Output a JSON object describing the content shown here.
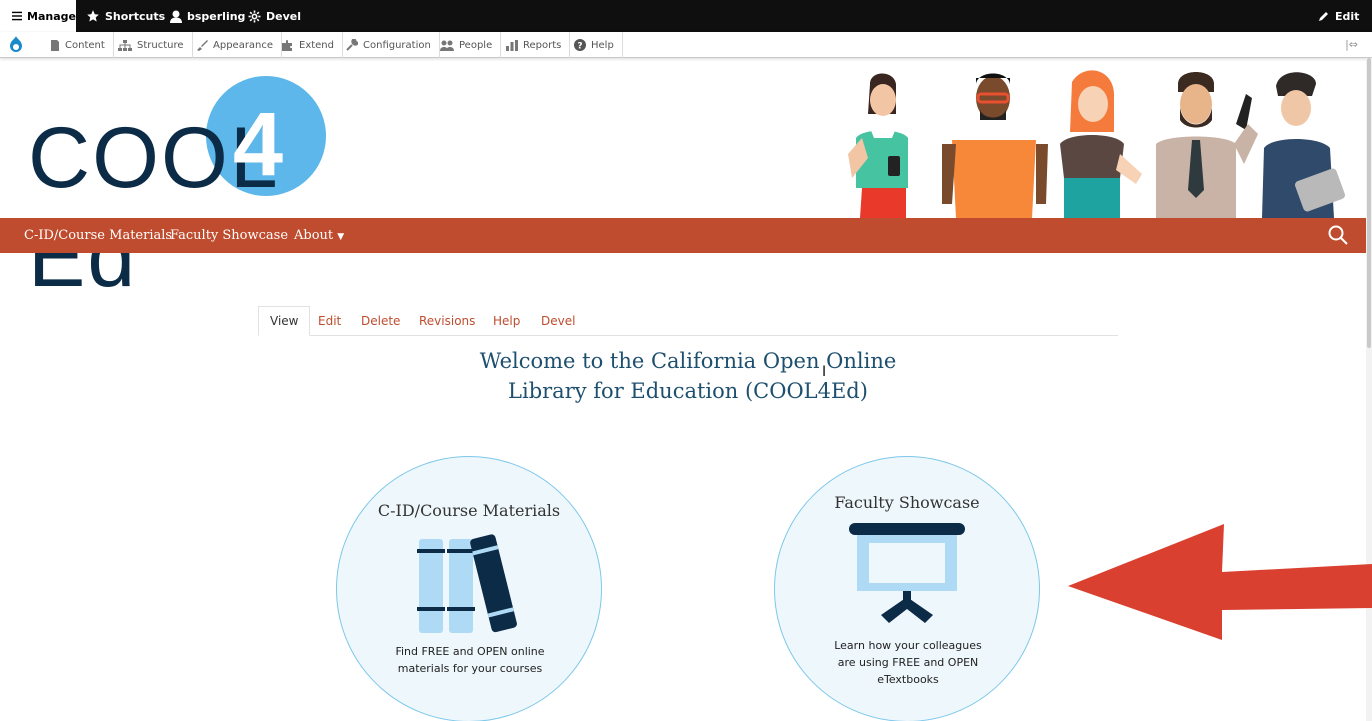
{
  "admin_bar": {
    "manage": "Manage",
    "shortcuts": "Shortcuts",
    "user": "bsperling",
    "devel": "Devel",
    "edit": "Edit"
  },
  "tray": {
    "items": [
      "Content",
      "Structure",
      "Appearance",
      "Extend",
      "Configuration",
      "People",
      "Reports",
      "Help"
    ]
  },
  "brand": {
    "logo_before": "COOL",
    "logo_digit": "4",
    "logo_after": "Ed"
  },
  "nav": {
    "items": [
      "C-ID/Course Materials",
      "Faculty Showcase",
      "About"
    ]
  },
  "tabs": [
    "View",
    "Edit",
    "Delete",
    "Revisions",
    "Help",
    "Devel"
  ],
  "content": {
    "welcome_line1": "Welcome to the California Open Online",
    "welcome_line2": "Library for Education (COOL4Ed)"
  },
  "cards": {
    "left": {
      "title": "C-ID/Course Materials",
      "desc_line1": "Find FREE and OPEN online",
      "desc_line2": "materials for your courses"
    },
    "right": {
      "title": "Faculty Showcase",
      "desc_line1": "Learn how your colleagues",
      "desc_line2": "are using FREE and OPEN",
      "desc_line3": "eTextbooks"
    }
  },
  "colors": {
    "nav": "#bf4c2e",
    "logo_circle": "#5db7ea",
    "logo_text": "#0b2b47",
    "card_border": "#7dc8ea",
    "arrow": "#d9402f"
  }
}
